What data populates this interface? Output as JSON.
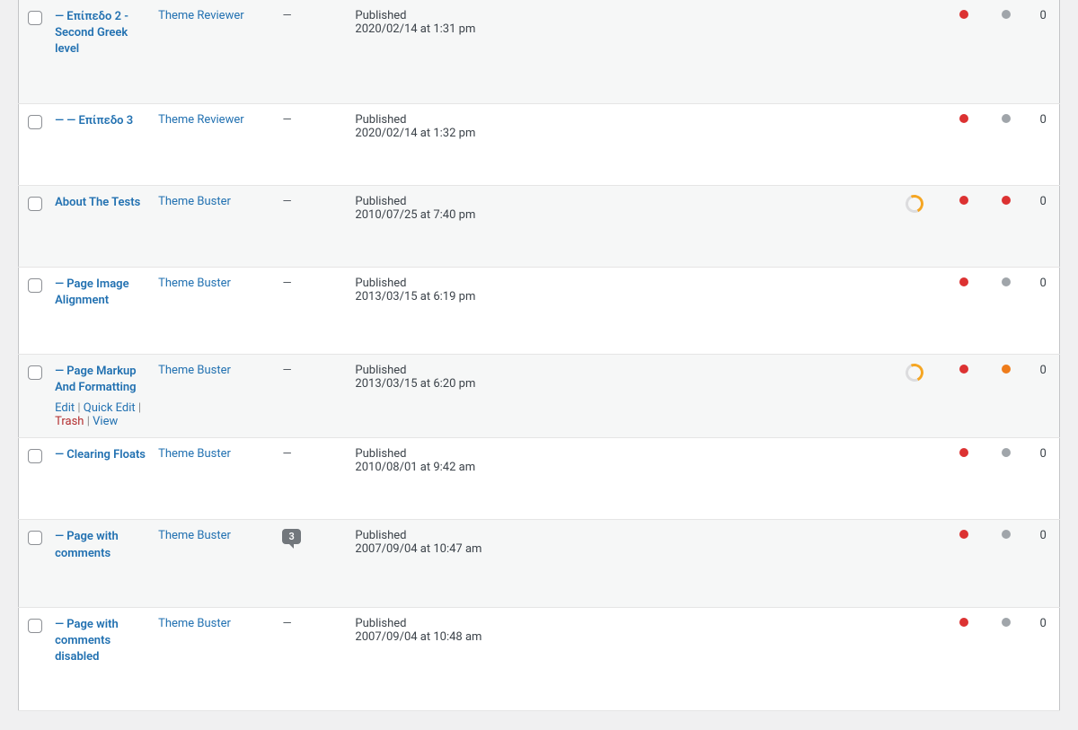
{
  "actions": {
    "edit": "Edit",
    "quick_edit": "Quick Edit",
    "trash": "Trash",
    "view": "View"
  },
  "rows": [
    {
      "alt": true,
      "title": "— Επίπεδο 2 - Second Greek level",
      "author": "Theme Reviewer",
      "comments": "—",
      "status": "Published",
      "date": "2020/02/14 at 1:31 pm",
      "seo_ring": false,
      "seo_b": "red",
      "seo_c": "grey",
      "links": "0",
      "show_actions": false
    },
    {
      "alt": false,
      "title": "— — Επίπεδο 3",
      "author": "Theme Reviewer",
      "comments": "—",
      "status": "Published",
      "date": "2020/02/14 at 1:32 pm",
      "seo_ring": false,
      "seo_b": "red",
      "seo_c": "grey",
      "links": "0",
      "show_actions": false
    },
    {
      "alt": true,
      "title": "About The Tests",
      "author": "Theme Buster",
      "comments": "—",
      "status": "Published",
      "date": "2010/07/25 at 7:40 pm",
      "seo_ring": true,
      "seo_b": "red",
      "seo_c": "red",
      "links": "0",
      "show_actions": false
    },
    {
      "alt": false,
      "title": "— Page Image Alignment",
      "author": "Theme Buster",
      "comments": "—",
      "status": "Published",
      "date": "2013/03/15 at 6:19 pm",
      "seo_ring": false,
      "seo_b": "red",
      "seo_c": "grey",
      "links": "0",
      "show_actions": false
    },
    {
      "alt": true,
      "title": "— Page Markup And Formatting",
      "author": "Theme Buster",
      "comments": "—",
      "status": "Published",
      "date": "2013/03/15 at 6:20 pm",
      "seo_ring": true,
      "seo_b": "red",
      "seo_c": "orange",
      "links": "0",
      "show_actions": true
    },
    {
      "alt": false,
      "title": "— Clearing Floats",
      "author": "Theme Buster",
      "comments": "—",
      "status": "Published",
      "date": "2010/08/01 at 9:42 am",
      "seo_ring": false,
      "seo_b": "red",
      "seo_c": "grey",
      "links": "0",
      "show_actions": false
    },
    {
      "alt": true,
      "title": "— Page with comments",
      "author": "Theme Buster",
      "comments": "3",
      "status": "Published",
      "date": "2007/09/04 at 10:47 am",
      "seo_ring": false,
      "seo_b": "red",
      "seo_c": "grey",
      "links": "0",
      "show_actions": false
    },
    {
      "alt": false,
      "title": "— Page with comments disabled",
      "author": "Theme Buster",
      "comments": "—",
      "status": "Published",
      "date": "2007/09/04 at 10:48 am",
      "seo_ring": false,
      "seo_b": "red",
      "seo_c": "grey",
      "links": "0",
      "show_actions": false
    }
  ]
}
